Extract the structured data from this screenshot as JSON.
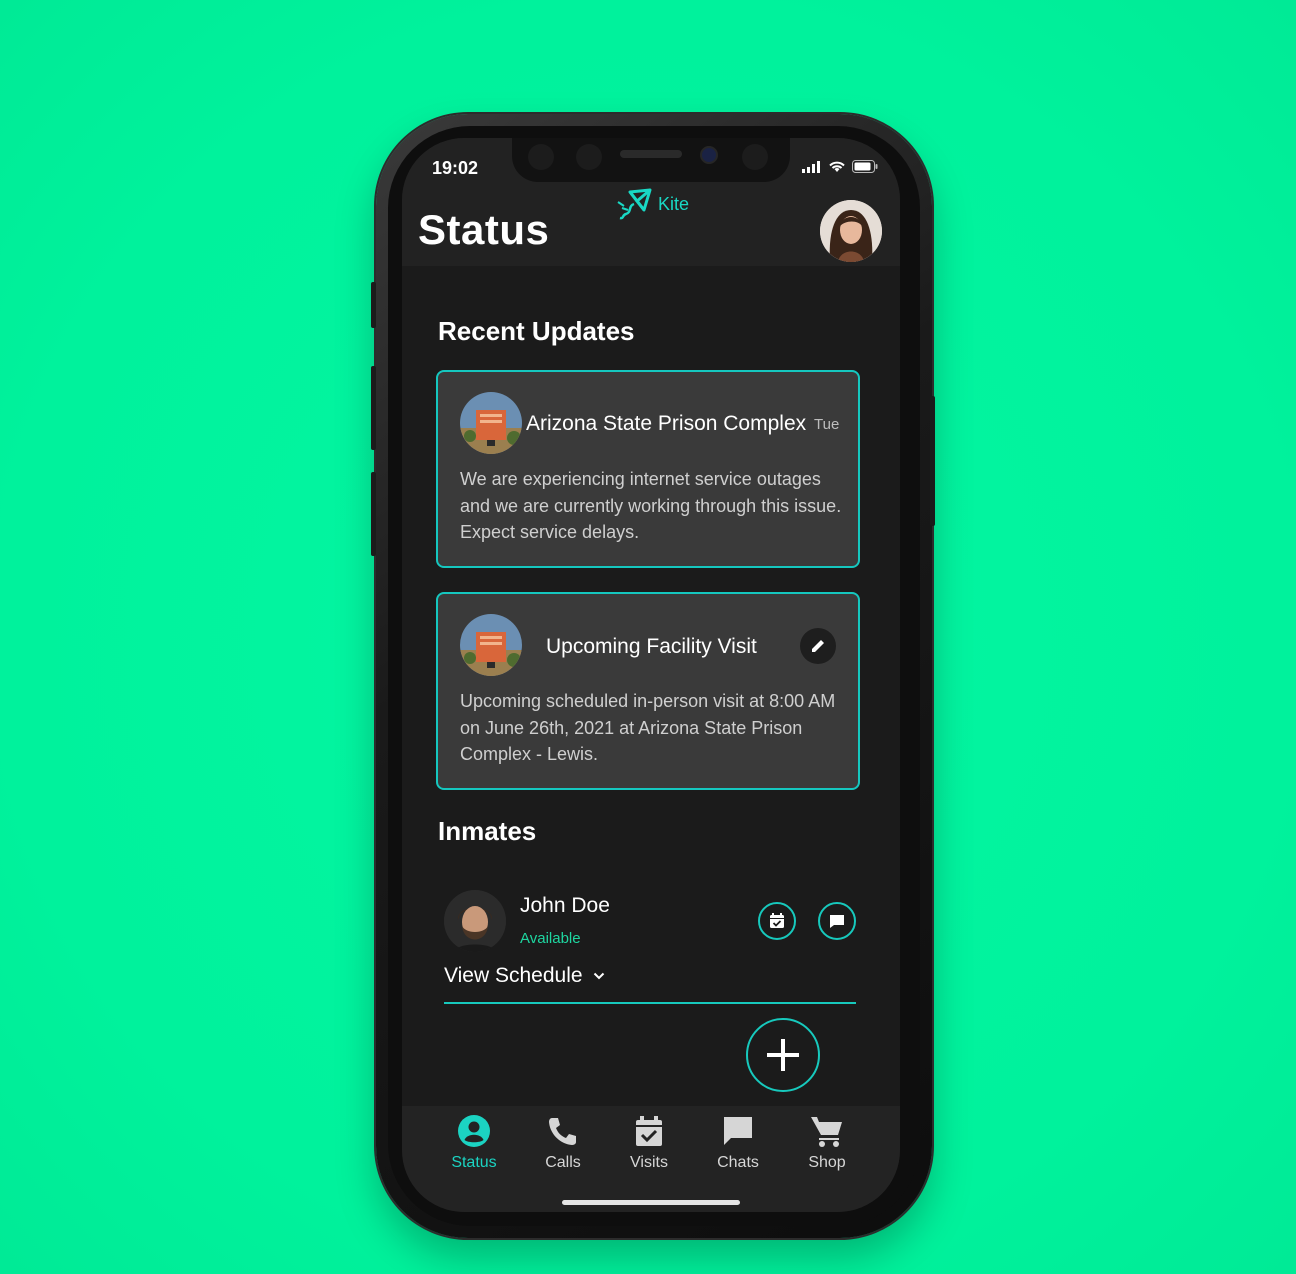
{
  "statusbar": {
    "time": "19:02"
  },
  "header": {
    "title": "Status",
    "brand": "Kite"
  },
  "recent_updates": {
    "title": "Recent Updates",
    "cards": [
      {
        "title": "Arizona State Prison Complex",
        "day": "Tue",
        "body": "We are experiencing internet service outages and we are currently working through this issue. Expect service delays."
      },
      {
        "title": "Upcoming Facility Visit",
        "body": "Upcoming scheduled in-person visit at 8:00 AM on June 26th, 2021 at Arizona State Prison Complex - Lewis."
      }
    ]
  },
  "inmates": {
    "title": "Inmates",
    "items": [
      {
        "name": "John Doe",
        "status": "Available",
        "schedule_label": "View Schedule"
      }
    ]
  },
  "tabs": [
    {
      "label": "Status",
      "icon": "user-circle-icon",
      "active": true
    },
    {
      "label": "Calls",
      "icon": "phone-icon",
      "active": false
    },
    {
      "label": "Visits",
      "icon": "calendar-check-icon",
      "active": false
    },
    {
      "label": "Chats",
      "icon": "chat-bubble-icon",
      "active": false
    },
    {
      "label": "Shop",
      "icon": "shopping-cart-icon",
      "active": false
    }
  ],
  "colors": {
    "background": "#00f29c",
    "accent": "#17c9bd",
    "available": "#1ed6a0",
    "card": "#3a3a3a"
  }
}
